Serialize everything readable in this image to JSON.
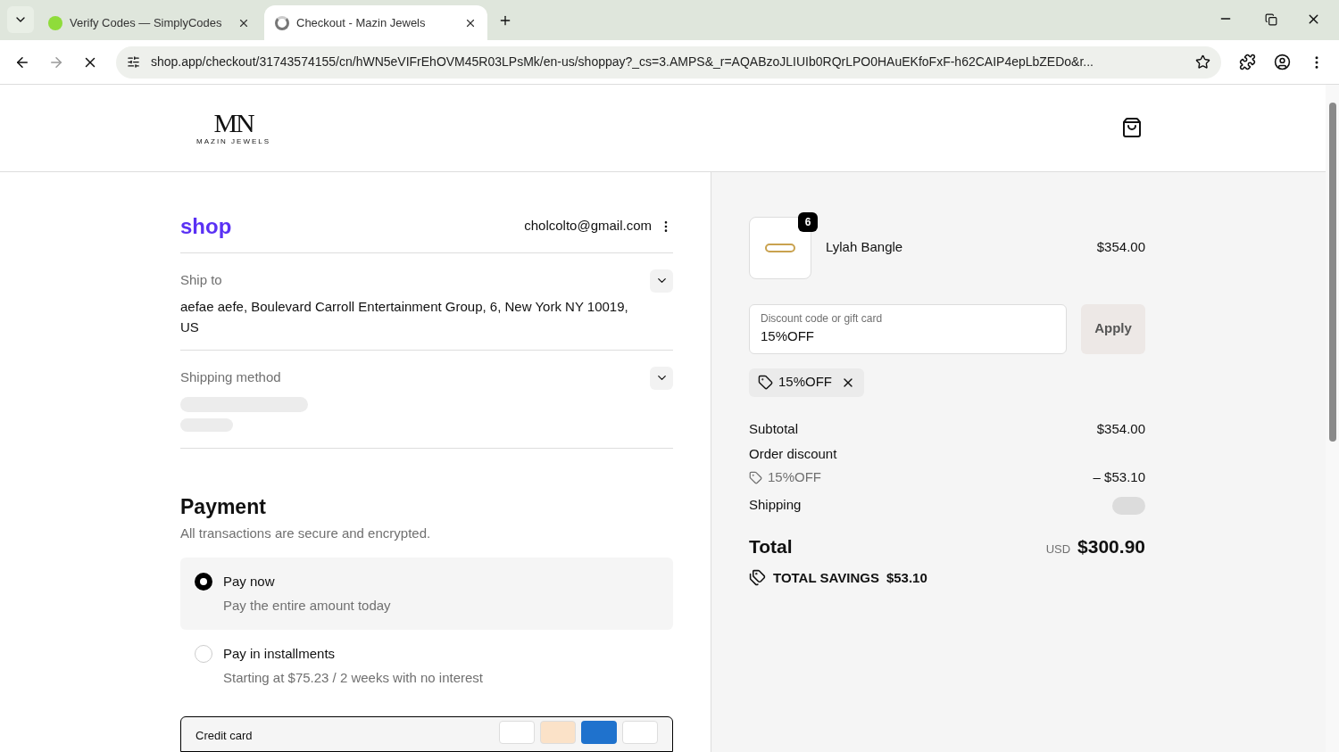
{
  "browser": {
    "tabs": [
      {
        "title": "Verify Codes — SimplyCodes",
        "selected": false,
        "kind": "simplycodes"
      },
      {
        "title": "Checkout - Mazin Jewels",
        "selected": true,
        "kind": "loading"
      }
    ],
    "url": "shop.app/checkout/31743574155/cn/hWN5eVIFrEhOVM45R03LPsMk/en-us/shoppay?_cs=3.AMPS&_r=AQABzoJLIUIb0RQrLPO0HAuEKfoFxF-h62CAIP4epLbZEDo&r..."
  },
  "header": {
    "logo_monogram": "MN",
    "logo_wordmark": "MAZIN JEWELS"
  },
  "account": {
    "brand": "shop",
    "email": "cholcolto@gmail.com"
  },
  "ship_to": {
    "label": "Ship to",
    "address": "aefae aefe, Boulevard Carroll Entertainment Group, 6, New York NY 10019, US"
  },
  "shipping_method": {
    "label": "Shipping method"
  },
  "payment": {
    "title": "Payment",
    "subtitle": "All transactions are secure and encrypted.",
    "options": [
      {
        "label": "Pay now",
        "detail": "Pay the entire amount today",
        "selected": true
      },
      {
        "label": "Pay in installments",
        "detail": "Starting at $75.23 / 2 weeks with no interest",
        "selected": false
      }
    ],
    "card_label": "Credit card"
  },
  "summary": {
    "item": {
      "name": "Lylah Bangle",
      "price": "$354.00",
      "quantity": "6"
    },
    "discount_field": {
      "placeholder": "Discount code or gift card",
      "value": "15%OFF",
      "button": "Apply"
    },
    "applied_code": "15%OFF",
    "subtotal": {
      "label": "Subtotal",
      "value": "$354.00"
    },
    "order_discount": {
      "label": "Order discount",
      "code": "15%OFF",
      "value": "– $53.10"
    },
    "shipping": {
      "label": "Shipping"
    },
    "total": {
      "label": "Total",
      "currency": "USD",
      "value": "$300.90"
    },
    "savings": {
      "label": "TOTAL SAVINGS",
      "value": "$53.10"
    }
  }
}
